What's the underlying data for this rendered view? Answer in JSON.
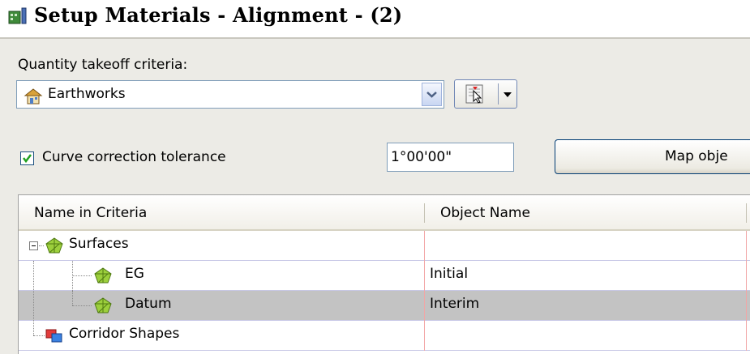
{
  "window": {
    "title": "Setup Materials - Alignment - (2)",
    "app_icon": "setup-materials-app-icon"
  },
  "criteria": {
    "label": "Quantity takeoff criteria:",
    "selected": "Earthworks",
    "icon": "criteria-house-icon"
  },
  "curve_correction": {
    "label": "Curve correction tolerance",
    "checked": true,
    "value": "1°00'00\""
  },
  "map_button": {
    "label": "Map obje"
  },
  "grid": {
    "columns": [
      "Name in Criteria",
      "Object Name"
    ],
    "rows": [
      {
        "name": "Surfaces",
        "object": "",
        "icon": "surface-icon",
        "expanded": true,
        "level": 0
      },
      {
        "name": "EG",
        "object": "Initial",
        "icon": "surface-icon",
        "level": 1
      },
      {
        "name": "Datum",
        "object": "Interim",
        "icon": "surface-icon",
        "level": 1,
        "selected": true
      },
      {
        "name": "Corridor Shapes",
        "object": "",
        "icon": "corridor-shapes-icon",
        "level": 0
      }
    ]
  },
  "colors": {
    "dialog_bg": "#ecebe6",
    "selection": "#c3c3c3",
    "row_divider_pink": "#f2a6a6",
    "checkbox_check": "#21a121"
  }
}
